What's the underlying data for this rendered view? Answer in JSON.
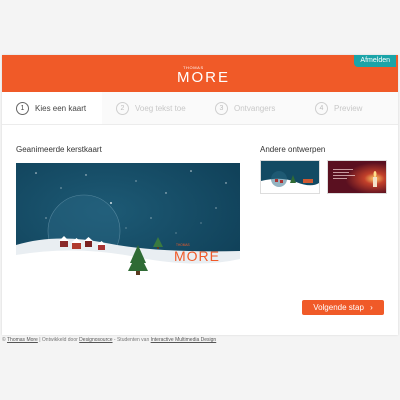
{
  "header": {
    "logo_small": "THOMAS",
    "logo_big": "MORE",
    "logout_label": "Afmelden"
  },
  "steps": [
    {
      "number": "1",
      "label": "Kies een kaart"
    },
    {
      "number": "2",
      "label": "Voeg tekst toe"
    },
    {
      "number": "3",
      "label": "Ontvangers"
    },
    {
      "number": "4",
      "label": "Preview"
    }
  ],
  "main": {
    "selected_title": "Geanimeerde kerstkaart",
    "others_title": "Andere ontwerpen",
    "card_logo_small": "THOMAS",
    "card_logo_big": "MORE",
    "next_button": "Volgende stap"
  },
  "colors": {
    "brand_orange": "#f05a28",
    "accent_teal": "#1aa4a8",
    "card_navy": "#134a63"
  },
  "icons": {
    "next_arrow": "chevron-right-icon"
  },
  "footer": {
    "copyright": "©",
    "brand_link": "Thomas More",
    "text1": " | Ontwikkeld door ",
    "dev_link": "Designosource",
    "text2": " - Studenten van ",
    "program_link": "Interactive Multimedia Design"
  }
}
